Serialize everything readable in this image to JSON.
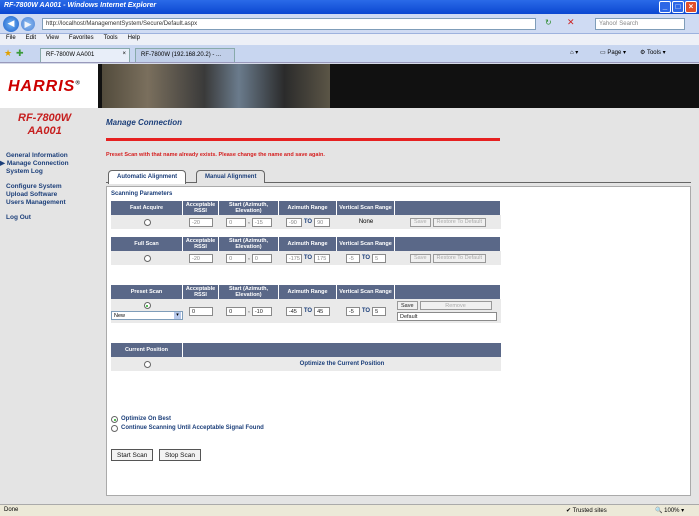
{
  "window": {
    "title": "RF-7800W AA001 - Windows Internet Explorer"
  },
  "address": {
    "url": "http://localhost/ManagementSystem/Secure/Default.aspx",
    "search_placeholder": "Yahoo! Search"
  },
  "menu": [
    "File",
    "Edit",
    "View",
    "Favorites",
    "Tools",
    "Help"
  ],
  "browser_tabs": [
    {
      "label": "RF-7800W AA001"
    },
    {
      "label": "RF-7800W (192.168.20.2) - ..."
    }
  ],
  "toolbar_right": {
    "page": "Page",
    "tools": "Tools"
  },
  "brand": {
    "logo_main": "HARRIS",
    "logo_dot": "®"
  },
  "device": {
    "line1": "RF-7800W",
    "line2": "AA001"
  },
  "nav": [
    {
      "label": "General Information",
      "active": false
    },
    {
      "label": "Manage Connection",
      "active": true
    },
    {
      "label": "System Log",
      "active": false
    },
    {
      "label": "Configure System",
      "active": false
    },
    {
      "label": "Upload Software",
      "active": false
    },
    {
      "label": "Users Management",
      "active": false
    },
    {
      "label": "Log Out",
      "active": false
    }
  ],
  "page": {
    "title": "Manage Connection",
    "error": "Preset Scan with that name already exists. Please change the name and save again."
  },
  "tabs": {
    "auto": "Automatic Alignment",
    "manual": "Manual Alignment"
  },
  "panel": {
    "title": "Scanning Parameters"
  },
  "headers": {
    "rssi": "Acceptable RSSI",
    "start": "Start (Azimuth, Elevation)",
    "azimuth": "Azimuth Range",
    "vertical": "Vertical Scan Range"
  },
  "fast": {
    "name": "Fast Acquire",
    "rssi": "-20",
    "az": "0",
    "el": "-15",
    "az_from": "-90",
    "to": "TO",
    "az_to": "90",
    "vertical": "None",
    "save": "Save",
    "restore": "Restore To Default"
  },
  "full": {
    "name": "Full Scan",
    "rssi": "-20",
    "az": "0",
    "el": "0",
    "az_from": "-175",
    "to": "TO",
    "az_to": "175",
    "v_from": "-5",
    "v_to": "5",
    "save": "Save",
    "restore": "Restore To Default"
  },
  "preset": {
    "name": "Preset Scan",
    "select": "New",
    "rssi": "0",
    "az": "0",
    "el": "-10",
    "az_from": "-45",
    "to": "TO",
    "az_to": "45",
    "v_from": "-5",
    "v_to": "5",
    "save": "Save",
    "remove": "Remove",
    "preset_name": "Default"
  },
  "current": {
    "name": "Current Position",
    "label": "Optimize the Current Position"
  },
  "options": {
    "opt1": "Optimize On Best",
    "opt2": "Continue Scanning Until Acceptable Signal Found"
  },
  "actions": {
    "start": "Start Scan",
    "stop": "Stop Scan"
  },
  "status": {
    "left": "Done",
    "zone": "Trusted sites",
    "zoom": "100%"
  }
}
